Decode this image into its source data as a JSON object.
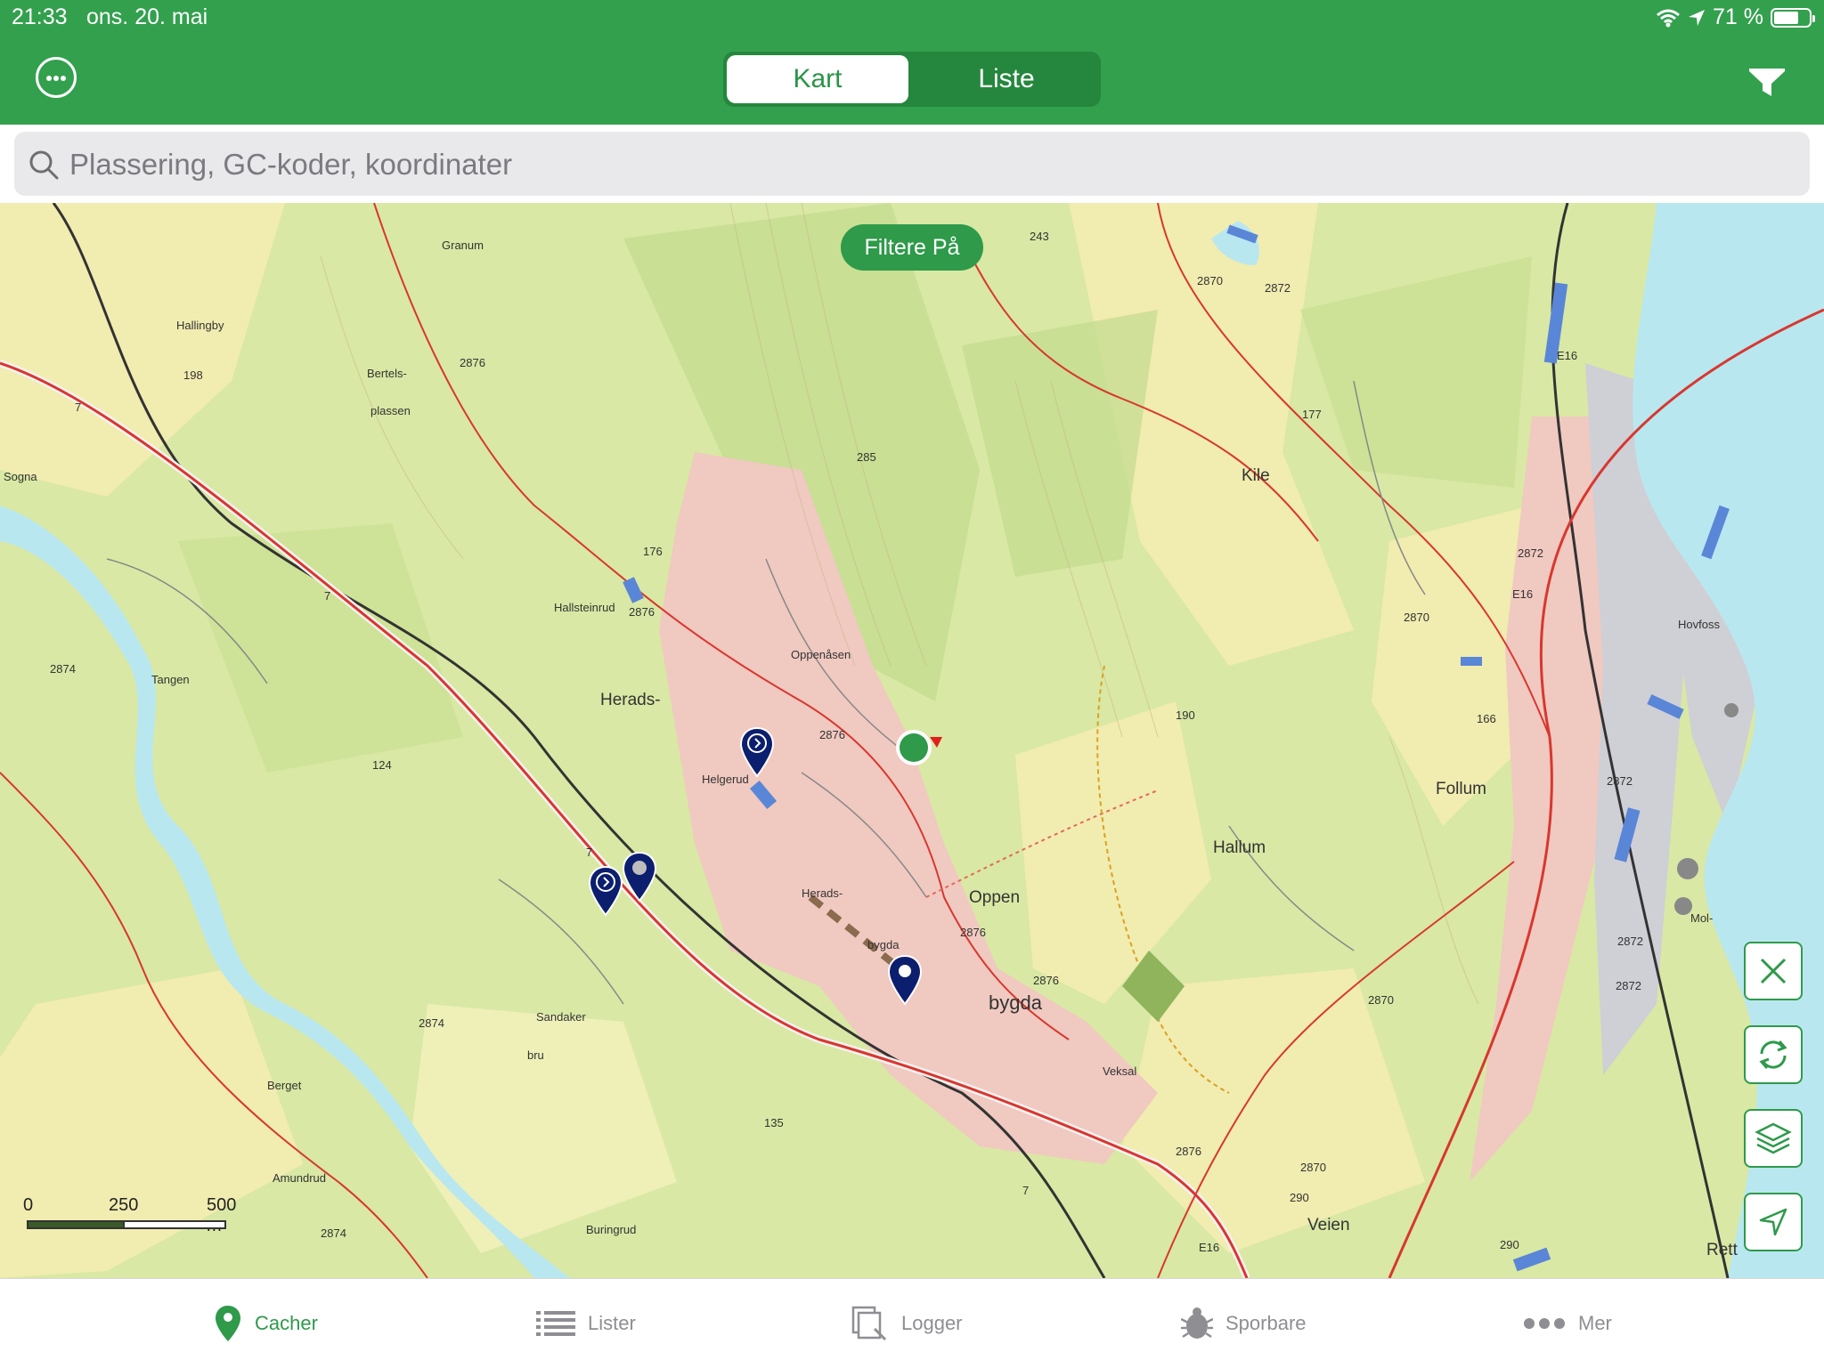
{
  "status_bar": {
    "time": "21:33",
    "date": "ons. 20. mai",
    "battery": "71 %",
    "battery_level": 0.71
  },
  "header": {
    "menu_icon": "more-circle-icon",
    "segments": [
      {
        "label": "Kart",
        "selected": true
      },
      {
        "label": "Liste",
        "selected": false
      }
    ],
    "filter_icon": "funnel-icon"
  },
  "search": {
    "placeholder": "Plassering, GC-koder, koordinater",
    "icon": "magnifier-icon"
  },
  "map": {
    "filter_badge": "Filtere På",
    "scale": {
      "labels": [
        "0",
        "250",
        "500 m"
      ]
    },
    "labels": [
      "Granum",
      "Hallingby",
      "198",
      "Bertels-",
      "plassen",
      "2876",
      "Sogna",
      "176",
      "Hallsteinrud",
      "2876",
      "2874",
      "Tangen",
      "Herads-",
      "124",
      "Oppenåsen",
      "2876",
      "Helgerud",
      "Herads-",
      "bygda",
      "Oppen",
      "2876",
      "2876",
      "bygda",
      "Sandaker",
      "bru",
      "2874",
      "Berget",
      "Amundrud",
      "135",
      "Veksal",
      "2876",
      "Buringrud",
      "2874",
      "285",
      "243",
      "2870",
      "2872",
      "177",
      "Kile",
      "2872",
      "2870",
      "190",
      "166",
      "Follum",
      "Hallum",
      "2870",
      "2872",
      "2872",
      "2872",
      "2870",
      "290",
      "Veien",
      "Hovfoss",
      "Mol-",
      "290",
      "Rett",
      "E16",
      "E16",
      "E16",
      "7",
      "7",
      "7",
      "7"
    ],
    "controls": [
      "close-icon",
      "refresh-icon",
      "layers-icon",
      "locate-arrow-icon"
    ],
    "colors": {
      "forest": "#d3e59a",
      "field": "#f3edb0",
      "residential": "#f0c8c0",
      "water": "#b9e7ef",
      "road": "#d8372f",
      "pin": "#0c1f6e",
      "accent": "#33a04e"
    }
  },
  "tabs": [
    {
      "label": "Cacher",
      "icon": "map-pin-icon",
      "active": true
    },
    {
      "label": "Lister",
      "icon": "list-icon",
      "active": false
    },
    {
      "label": "Logger",
      "icon": "logs-icon",
      "active": false
    },
    {
      "label": "Sporbare",
      "icon": "trackable-bug-icon",
      "active": false
    },
    {
      "label": "Mer",
      "icon": "more-dots-icon",
      "active": false
    }
  ]
}
